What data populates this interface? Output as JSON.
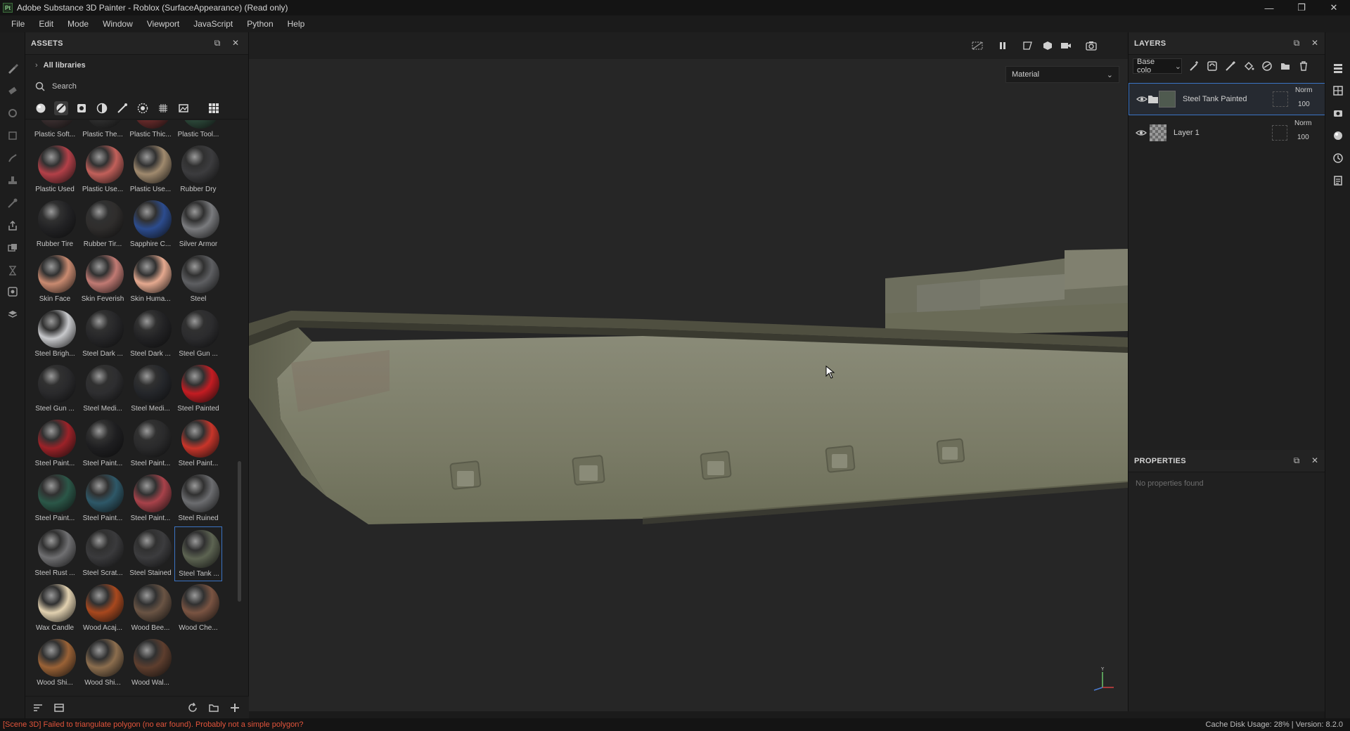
{
  "window": {
    "title": "Adobe Substance 3D Painter - Roblox (SurfaceAppearance) (Read only)",
    "app_icon": "Pt",
    "controls": [
      "minimize-icon",
      "restore-icon",
      "close-icon"
    ]
  },
  "menu": [
    "File",
    "Edit",
    "Mode",
    "Window",
    "Viewport",
    "JavaScript",
    "Python",
    "Help"
  ],
  "assets": {
    "title": "ASSETS",
    "libraries": "All libraries",
    "search_placeholder": "Search",
    "items": [
      {
        "label": "Plastic Soft...",
        "color": "#3b2f30"
      },
      {
        "label": "Plastic The...",
        "color": "#2f2f2f"
      },
      {
        "label": "Plastic Thic...",
        "color": "#6a2b2b"
      },
      {
        "label": "Plastic Tool...",
        "color": "#2d4a3b"
      },
      {
        "label": "Plastic Used",
        "color": "#b34048"
      },
      {
        "label": "Plastic Use...",
        "color": "#c2605a"
      },
      {
        "label": "Plastic Use...",
        "color": "#a08a6e"
      },
      {
        "label": "Rubber Dry",
        "color": "#3c3c3e"
      },
      {
        "label": "Rubber Tire",
        "color": "#222224"
      },
      {
        "label": "Rubber Tir...",
        "color": "#2f2d2c"
      },
      {
        "label": "Sapphire C...",
        "color": "#2c4c8e"
      },
      {
        "label": "Silver Armor",
        "color": "#7a7b7e"
      },
      {
        "label": "Skin Face",
        "color": "#c98a70"
      },
      {
        "label": "Skin Feverish",
        "color": "#c17a73"
      },
      {
        "label": "Skin Huma...",
        "color": "#e5a98f"
      },
      {
        "label": "Steel",
        "color": "#5e5f62"
      },
      {
        "label": "Steel Brigh...",
        "color": "#c8c9cc"
      },
      {
        "label": "Steel Dark ...",
        "color": "#262628"
      },
      {
        "label": "Steel Dark ...",
        "color": "#222224"
      },
      {
        "label": "Steel Gun ...",
        "color": "#2c2c2e"
      },
      {
        "label": "Steel Gun ...",
        "color": "#2a2a2c"
      },
      {
        "label": "Steel Medi...",
        "color": "#2e2e30"
      },
      {
        "label": "Steel Medi...",
        "color": "#24262a"
      },
      {
        "label": "Steel Painted",
        "color": "#c41c22"
      },
      {
        "label": "Steel Paint...",
        "color": "#9c2228"
      },
      {
        "label": "Steel Paint...",
        "color": "#1e1e20"
      },
      {
        "label": "Steel Paint...",
        "color": "#2a2a2b"
      },
      {
        "label": "Steel Paint...",
        "color": "#c8352a"
      },
      {
        "label": "Steel Paint...",
        "color": "#2b5748"
      },
      {
        "label": "Steel Paint...",
        "color": "#2e5868"
      },
      {
        "label": "Steel Paint...",
        "color": "#a8424a"
      },
      {
        "label": "Steel Ruined",
        "color": "#6c6d70"
      },
      {
        "label": "Steel Rust ...",
        "color": "#707072"
      },
      {
        "label": "Steel Scrat...",
        "color": "#3a3a3c"
      },
      {
        "label": "Steel Stained",
        "color": "#3c3c3e"
      },
      {
        "label": "Steel Tank ...",
        "color": "#5d6452"
      },
      {
        "label": "Wax Candle",
        "color": "#e2d1b0"
      },
      {
        "label": "Wood Acaj...",
        "color": "#a8481e"
      },
      {
        "label": "Wood Bee...",
        "color": "#6a5444"
      },
      {
        "label": "Wood Che...",
        "color": "#7a5442"
      },
      {
        "label": "Wood Shi...",
        "color": "#9a6236"
      },
      {
        "label": "Wood Shi...",
        "color": "#8c6e4e"
      },
      {
        "label": "Wood Wal...",
        "color": "#5e3e2e"
      }
    ],
    "selected_index": 35
  },
  "viewport": {
    "mode_select": "Material"
  },
  "layers": {
    "title": "LAYERS",
    "channel_select": "Base colo",
    "rows": [
      {
        "name": "Steel Tank Painted",
        "blend": "Norm",
        "opacity": "100",
        "selected": true
      },
      {
        "name": "Layer 1",
        "blend": "Norm",
        "opacity": "100",
        "selected": false
      }
    ]
  },
  "properties": {
    "title": "PROPERTIES",
    "empty_text": "No properties found"
  },
  "status": {
    "error": "[Scene 3D] Failed to triangulate polygon (no ear found). Probably not a simple polygon?",
    "right": "Cache Disk Usage:   28% | Version: 8.2.0"
  },
  "accent_color": "#3b74c4",
  "error_color": "#e2543b"
}
